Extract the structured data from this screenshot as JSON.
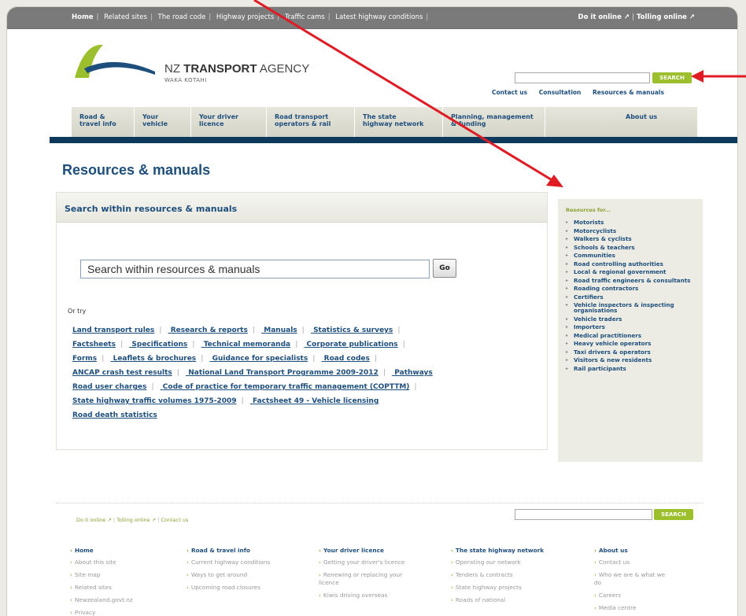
{
  "topbar": {
    "left_links": [
      "Home",
      "Related sites",
      "The road code",
      "Highway projects",
      "Traffic cams",
      "Latest highway conditions"
    ],
    "right_links": [
      "Do it online",
      "Tolling online"
    ]
  },
  "brand": {
    "name_bold": "TRANSPORT",
    "name_pre": "NZ ",
    "name_post": " AGENCY",
    "sub": "WAKA KOTAHI"
  },
  "header_search": {
    "button": "SEARCH"
  },
  "util_links": [
    "Contact us",
    "Consultation",
    "Resources & manuals"
  ],
  "nav": [
    {
      "l1": "Road &",
      "l2": "travel info"
    },
    {
      "l1": "Your",
      "l2": "vehicle"
    },
    {
      "l1": "Your driver",
      "l2": "licence"
    },
    {
      "l1": "Road transport",
      "l2": "operators & rail"
    },
    {
      "l1": "The state",
      "l2": "highway network"
    },
    {
      "l1": "Planning, management",
      "l2": "& funding"
    },
    {
      "l1": "About us",
      "l2": ""
    }
  ],
  "page_title": "Resources & manuals",
  "main": {
    "heading": "Search within resources & manuals",
    "search_value": "Search within resources & manuals",
    "go": "Go",
    "or_try": "Or try",
    "rows": [
      [
        "Land transport rules",
        "Research & reports",
        "Manuals",
        "Statistics & surveys"
      ],
      [
        "Factsheets",
        "Specifications",
        "Technical memoranda",
        "Corporate publications"
      ],
      [
        "Forms",
        "Leaflets & brochures",
        "Guidance for specialists",
        "Road codes"
      ],
      [
        "ANCAP crash test results",
        "National Land Transport Programme 2009-2012",
        "Pathways"
      ],
      [
        "Road user charges",
        "Code of practice for temporary traffic management (COPTTM)"
      ],
      [
        "State highway traffic volumes 1975-2009",
        "Factsheet 49 - Vehicle licensing"
      ],
      [
        "Road death statistics"
      ]
    ]
  },
  "sidebar": {
    "heading": "Resources for...",
    "items": [
      "Motorists",
      "Motorcyclists",
      "Walkers & cyclists",
      "Schools & teachers",
      "Communities",
      "Road controlling authorities",
      "Local & regional government",
      "Road traffic engineers & consultants",
      "Roading contractors",
      "Certifiers",
      "Vehicle inspectors & inspecting organisations",
      "Vehicle traders",
      "Importers",
      "Medical practitioners",
      "Heavy vehicle operators",
      "Taxi drivers & operators",
      "Visitors & new residents",
      "Rail participants"
    ]
  },
  "footer": {
    "links": [
      "Do it online",
      "Tolling online",
      "Contact us"
    ],
    "search_button": "SEARCH",
    "columns": [
      {
        "head": "Home",
        "items": [
          "About this site",
          "Site map",
          "Related sites",
          "Newzealand.govt.nz",
          "Privacy"
        ]
      },
      {
        "head": "Road & travel info",
        "items": [
          "Current highway conditions",
          "Ways to get around",
          "Upcoming road closures"
        ]
      },
      {
        "head": "Your driver licence",
        "items": [
          "Getting your driver's licence",
          "Renewing or replacing your licence",
          "Kiwis driving overseas"
        ]
      },
      {
        "head": "The state highway network",
        "items": [
          "Operating our network",
          "Tenders & contracts",
          "State highway projects",
          "Roads of national"
        ]
      },
      {
        "head": "About us",
        "items": [
          "Contact us",
          "Who we are & what we do",
          "Careers",
          "Media centre"
        ]
      }
    ]
  },
  "colors": {
    "navy": "#1e4e7c",
    "green": "#9cbf2e",
    "arrow": "#e01b24"
  }
}
